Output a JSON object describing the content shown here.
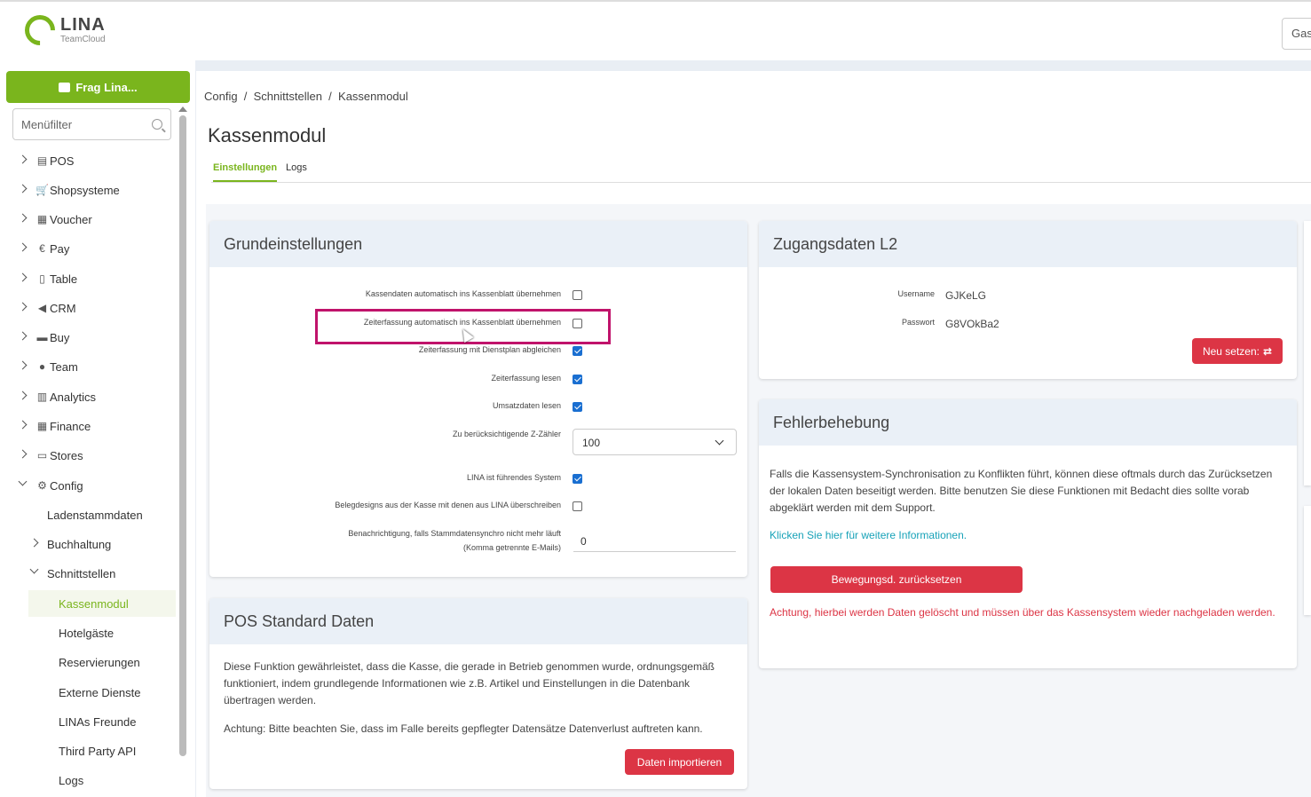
{
  "header": {
    "logo_title": "LINA",
    "logo_subtitle": "TeamCloud",
    "user_button": "Gast"
  },
  "sidebar": {
    "ask_button": "Frag Lina...",
    "filter_placeholder": "Menüfilter",
    "items": [
      {
        "label": "POS",
        "icon": "cash-register-icon",
        "glyph": "▤"
      },
      {
        "label": "Shopsysteme",
        "icon": "cart-icon",
        "glyph": "🛒"
      },
      {
        "label": "Voucher",
        "icon": "gift-icon",
        "glyph": "▦"
      },
      {
        "label": "Pay",
        "icon": "euro-icon",
        "glyph": "€"
      },
      {
        "label": "Table",
        "icon": "book-icon",
        "glyph": "▯"
      },
      {
        "label": "CRM",
        "icon": "megaphone-icon",
        "glyph": "◀"
      },
      {
        "label": "Buy",
        "icon": "truck-icon",
        "glyph": "▬"
      },
      {
        "label": "Team",
        "icon": "users-icon",
        "glyph": "●"
      },
      {
        "label": "Analytics",
        "icon": "chart-icon",
        "glyph": "▥"
      },
      {
        "label": "Finance",
        "icon": "calculator-icon",
        "glyph": "▦"
      },
      {
        "label": "Stores",
        "icon": "store-icon",
        "glyph": "▭"
      },
      {
        "label": "Config",
        "icon": "gears-icon",
        "glyph": "⚙"
      }
    ],
    "config_children": {
      "ladenstammdaten": "Ladenstammdaten",
      "buchhaltung": "Buchhaltung",
      "schnittstellen": "Schnittstellen"
    },
    "schnittstellen_children": [
      "Kassenmodul",
      "Hotelgäste",
      "Reservierungen",
      "Externe Dienste",
      "LINAs Freunde",
      "Third Party API",
      "Logs"
    ]
  },
  "main": {
    "breadcrumb": "Config  /  Schnittstellen  /  Kassenmodul",
    "title": "Kassenmodul",
    "tabs": [
      "Einstellungen",
      "Logs"
    ]
  },
  "grundeinstellungen": {
    "title": "Grundeinstellungen",
    "rows": [
      {
        "label": "Kassendaten automatisch ins Kassenblatt übernehmen",
        "checked": false
      },
      {
        "label": "Zeiterfassung automatisch ins Kassenblatt übernehmen",
        "checked": false
      },
      {
        "label": "Zeiterfassung mit Dienstplan abgleichen",
        "checked": true
      },
      {
        "label": "Zeiterfassung lesen",
        "checked": true
      },
      {
        "label": "Umsatzdaten lesen",
        "checked": true
      }
    ],
    "z_counter_label": "Zu berücksichtigende Z-Zähler",
    "z_counter_value": "100",
    "lina_master_label": "LINA ist führendes System",
    "lina_master_checked": true,
    "beleg_label": "Belegdesigns aus der Kasse mit denen aus LINA überschreiben",
    "beleg_checked": false,
    "notify_label_1": "Benachrichtigung, falls Stammdatensynchro nicht mehr läuft",
    "notify_label_2": "(Komma getrennte E-Mails)",
    "notify_value": "0"
  },
  "pos_standard": {
    "title": "POS Standard Daten",
    "text_1": "Diese Funktion gewährleistet, dass die Kasse, die gerade in Betrieb genommen wurde, ordnungsgemäß funktioniert, indem grundlegende Informationen wie z.B. Artikel und Einstellungen in die Datenbank übertragen werden.",
    "text_2": "Achtung: Bitte beachten Sie, dass im Falle bereits gepflegter Datensätze Datenverlust auftreten kann.",
    "button": "Daten importieren"
  },
  "zugangsdaten": {
    "title": "Zugangsdaten L2",
    "username_label": "Username",
    "username_value": "GJKeLG",
    "password_label": "Passwort",
    "password_value": "G8VOkBa2",
    "button": "Neu setzen:"
  },
  "fehlerbehebung": {
    "title": "Fehlerbehebung",
    "text": "Falls die Kassensystem-Synchronisation zu Konflikten führt, können diese oftmals durch das Zurücksetzen der lokalen Daten beseitigt werden. Bitte benutzen Sie diese Funktionen mit Bedacht dies sollte vorab abgeklärt werden mit dem Support.",
    "link": "Klicken Sie hier für weitere Informationen.",
    "button": "Bewegungsd. zurücksetzen",
    "warning": "Achtung, hierbei werden Daten gelöscht und müssen über das Kassensystem wieder nachgeladen werden."
  },
  "colors": {
    "brand_green": "#7ab51d",
    "danger_red": "#dc3545",
    "highlight_magenta": "#c0136b",
    "link_teal": "#17a2b8"
  }
}
